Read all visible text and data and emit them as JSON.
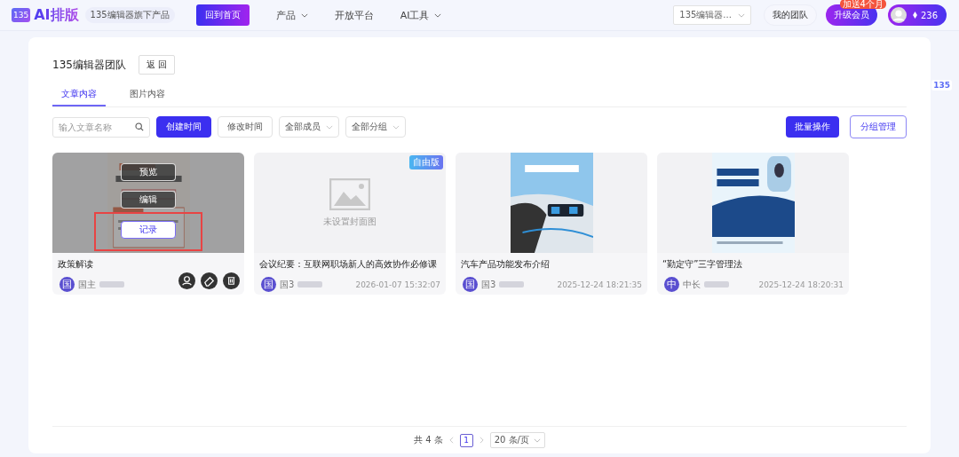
{
  "nav": {
    "logo": "AI排版",
    "logo_mark": "135",
    "tagline": "135编辑器旗下产品",
    "home_button": "回到首页",
    "menu": [
      {
        "label": "产品",
        "dropdown": true
      },
      {
        "label": "开放平台",
        "dropdown": false
      },
      {
        "label": "AI工具",
        "dropdown": true
      }
    ],
    "team_select": "135编辑器...",
    "my_team": "我的团队",
    "upgrade": "升级会员",
    "upgrade_badge": "加送4个月",
    "points": "236"
  },
  "side_logo": "135",
  "header": {
    "title": "135编辑器团队",
    "back": "返 回"
  },
  "tabs": [
    {
      "label": "文章内容",
      "selected": true
    },
    {
      "label": "图片内容",
      "selected": false
    }
  ],
  "filters": {
    "search_placeholder": "输入文章名称",
    "sort": [
      {
        "label": "创建时间",
        "selected": true
      },
      {
        "label": "修改时间",
        "selected": false
      }
    ],
    "selects": [
      "全部成员",
      "全部分组"
    ],
    "batch": "批量操作",
    "group_manage": "分组管理"
  },
  "cards": [
    {
      "title": "政策解读",
      "cover": {
        "kind": "picture"
      },
      "hovered": true,
      "actions": [
        {
          "label": "预览",
          "highlighted": false
        },
        {
          "label": "编辑",
          "highlighted": false
        },
        {
          "label": "记录",
          "highlighted": true
        }
      ],
      "avatar": "国",
      "author": "国主"
    },
    {
      "title": "会议纪要：互联网职场新人的高效协作必修课",
      "cover": {
        "kind": "placeholder",
        "text": "未设置封面图"
      },
      "badge": "自由版",
      "hovered": false,
      "avatar": "国",
      "author": "国3",
      "date": "2026-01-07 15:32:07"
    },
    {
      "title": "汽车产品功能发布介绍",
      "cover": {
        "kind": "picture"
      },
      "hovered": false,
      "avatar": "国",
      "author": "国3",
      "date": "2025-12-24 18:21:35"
    },
    {
      "title": "“勤定守”三字管理法",
      "cover": {
        "kind": "picture"
      },
      "hovered": false,
      "avatar": "中",
      "author": "中长",
      "date": "2025-12-24 18:20:31"
    }
  ],
  "pagination": {
    "total": "共 4 条",
    "pages": [
      {
        "label": "1",
        "selected": true
      }
    ],
    "page_size": "20 条/页"
  }
}
